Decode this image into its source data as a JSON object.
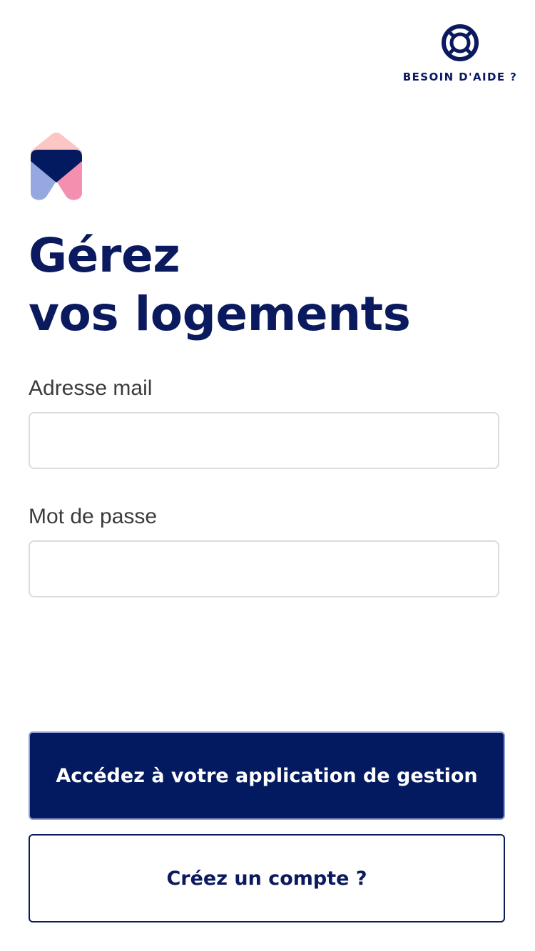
{
  "header": {
    "help_label": "BESOIN D'AIDE ?",
    "help_icon": "lifebuoy-icon"
  },
  "logo": {
    "icon": "house-logo-icon"
  },
  "title": {
    "line1": "Gérez",
    "line2": "vos logements"
  },
  "form": {
    "email_label": "Adresse mail",
    "email_value": "",
    "password_label": "Mot de passe",
    "password_value": ""
  },
  "actions": {
    "login_label": "Accédez à votre application de gestion",
    "signup_label": "Créez un compte ?"
  },
  "colors": {
    "brand_navy": "#041a60",
    "logo_pink_light": "#fbc6c4",
    "logo_pink": "#f58fb0",
    "logo_blue_light": "#96a8e0"
  }
}
